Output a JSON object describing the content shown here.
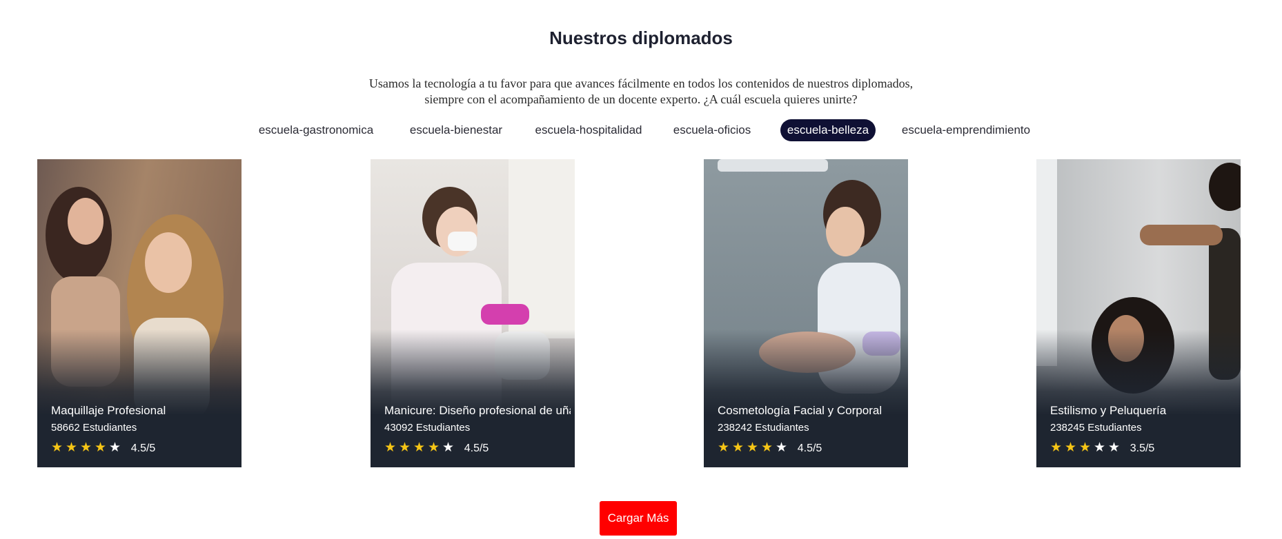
{
  "section": {
    "title": "Nuestros diplomados",
    "subtitle_line1": "Usamos la tecnología a tu favor para que avances fácilmente en todos los contenidos de nuestros diplomados,",
    "subtitle_line2": "siempre con el acompañamiento de un docente experto. ¿A cuál escuela quieres unirte?"
  },
  "tabs": [
    {
      "label": "escuela-gastronomica",
      "active": false
    },
    {
      "label": "escuela-bienestar",
      "active": false
    },
    {
      "label": "escuela-hospitalidad",
      "active": false
    },
    {
      "label": "escuela-oficios",
      "active": false
    },
    {
      "label": "escuela-belleza",
      "active": true
    },
    {
      "label": "escuela-emprendimiento",
      "active": false
    }
  ],
  "courses": [
    {
      "name": "Maquillaje Profesional",
      "students": "58662 Estudiantes",
      "rating": 4.5,
      "rating_label": "4.5/5",
      "stars_filled": 4
    },
    {
      "name": "Manicure: Diseño profesional de uñas",
      "students": "43092 Estudiantes",
      "rating": 4.5,
      "rating_label": "4.5/5",
      "stars_filled": 4
    },
    {
      "name": "Cosmetología Facial y Corporal",
      "students": "238242 Estudiantes",
      "rating": 4.5,
      "rating_label": "4.5/5",
      "stars_filled": 4
    },
    {
      "name": "Estilismo y Peluquería",
      "students": "238245 Estudiantes",
      "rating": 3.5,
      "rating_label": "3.5/5",
      "stars_filled": 3
    }
  ],
  "load_more_label": "Cargar Más",
  "colors": {
    "active_tab": "#0f1034",
    "card_bg": "#1e2530",
    "star_filled": "#f5c516",
    "load_more": "#ff0000"
  }
}
